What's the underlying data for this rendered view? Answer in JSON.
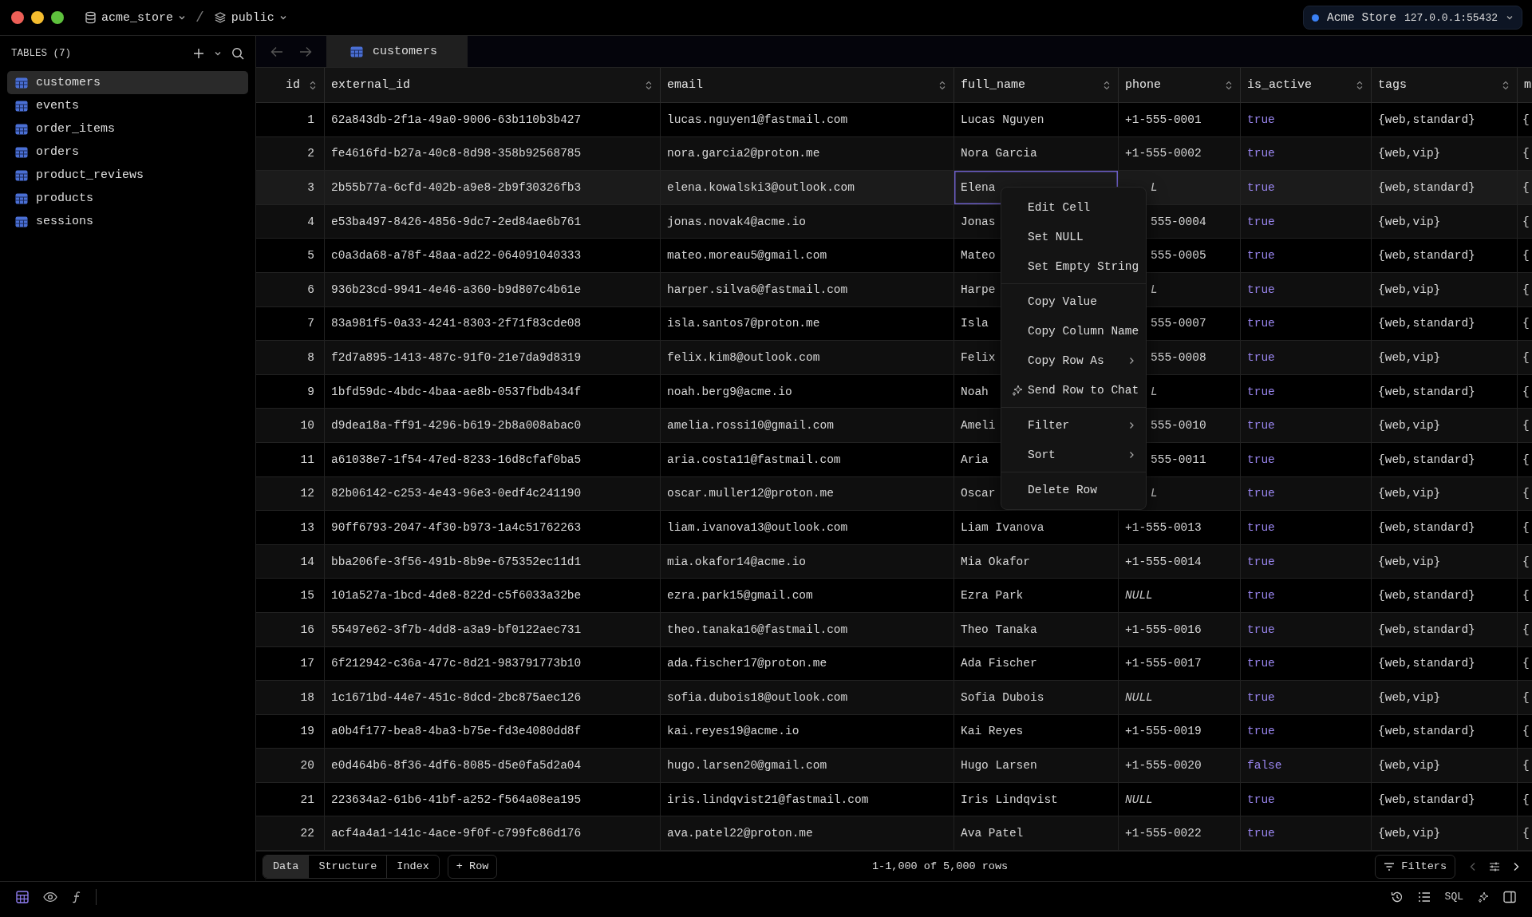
{
  "titlebar": {
    "database": "acme_store",
    "separator": "/",
    "schema": "public",
    "connection": {
      "name": "Acme Store",
      "address": "127.0.0.1:55432",
      "color": "#3b82f6"
    }
  },
  "sidebar": {
    "title": "TABLES (7)",
    "items": [
      {
        "label": "customers",
        "selected": true
      },
      {
        "label": "events",
        "selected": false
      },
      {
        "label": "order_items",
        "selected": false
      },
      {
        "label": "orders",
        "selected": false
      },
      {
        "label": "product_reviews",
        "selected": false
      },
      {
        "label": "products",
        "selected": false
      },
      {
        "label": "sessions",
        "selected": false
      }
    ]
  },
  "tabs": [
    {
      "label": "customers",
      "selected": true
    }
  ],
  "table": {
    "columns": [
      {
        "label": "id",
        "kind": "number"
      },
      {
        "label": "external_id",
        "kind": "plain"
      },
      {
        "label": "email",
        "kind": "plain"
      },
      {
        "label": "full_name",
        "kind": "plain"
      },
      {
        "label": "phone",
        "kind": "plain"
      },
      {
        "label": "is_active",
        "kind": "boolean"
      },
      {
        "label": "tags",
        "kind": "plain"
      },
      {
        "label": "m",
        "kind": "partial"
      }
    ],
    "rows": [
      {
        "selected": false,
        "cells": [
          "1",
          "62a843db-2f1a-49a0-9006-63b110b3b427",
          "lucas.nguyen1@fastmail.com",
          "Lucas Nguyen",
          "+1-555-0001",
          "true",
          "{web,standard}",
          "{"
        ]
      },
      {
        "selected": false,
        "cells": [
          "2",
          "fe4616fd-b27a-40c8-8d98-358b92568785",
          "nora.garcia2@proton.me",
          "Nora Garcia",
          "+1-555-0002",
          "true",
          "{web,vip}",
          "{"
        ]
      },
      {
        "selected": true,
        "cells": [
          "3",
          "2b55b77a-6cfd-402b-a9e8-2b9f30326fb3",
          "elena.kowalski3@outlook.com",
          {
            "text": "Elena",
            "kind": "focused"
          },
          {
            "text": "L",
            "kind": "covered-null"
          },
          "true",
          "{web,standard}",
          "{"
        ]
      },
      {
        "selected": false,
        "cells": [
          "4",
          "e53ba497-8426-4856-9dc7-2ed84ae6b761",
          "jonas.novak4@acme.io",
          "Jonas",
          {
            "text": "555-0004",
            "kind": "covered"
          },
          "true",
          "{web,vip}",
          "{"
        ]
      },
      {
        "selected": false,
        "cells": [
          "5",
          "c0a3da68-a78f-48aa-ad22-064091040333",
          "mateo.moreau5@gmail.com",
          "Mateo",
          {
            "text": "555-0005",
            "kind": "covered"
          },
          "true",
          "{web,standard}",
          "{"
        ]
      },
      {
        "selected": false,
        "cells": [
          "6",
          "936b23cd-9941-4e46-a360-b9d807c4b61e",
          "harper.silva6@fastmail.com",
          "Harpe",
          {
            "text": "L",
            "kind": "covered-null"
          },
          "true",
          "{web,vip}",
          "{"
        ]
      },
      {
        "selected": false,
        "cells": [
          "7",
          "83a981f5-0a33-4241-8303-2f71f83cde08",
          "isla.santos7@proton.me",
          "Isla",
          {
            "text": "555-0007",
            "kind": "covered"
          },
          "true",
          "{web,standard}",
          "{"
        ]
      },
      {
        "selected": false,
        "cells": [
          "8",
          "f2d7a895-1413-487c-91f0-21e7da9d8319",
          "felix.kim8@outlook.com",
          "Felix",
          {
            "text": "555-0008",
            "kind": "covered"
          },
          "true",
          "{web,vip}",
          "{"
        ]
      },
      {
        "selected": false,
        "cells": [
          "9",
          "1bfd59dc-4bdc-4baa-ae8b-0537fbdb434f",
          "noah.berg9@acme.io",
          "Noah",
          {
            "text": "L",
            "kind": "covered-null"
          },
          "true",
          "{web,standard}",
          "{"
        ]
      },
      {
        "selected": false,
        "cells": [
          "10",
          "d9dea18a-ff91-4296-b619-2b8a008abac0",
          "amelia.rossi10@gmail.com",
          "Ameli",
          {
            "text": "555-0010",
            "kind": "covered"
          },
          "true",
          "{web,vip}",
          "{"
        ]
      },
      {
        "selected": false,
        "cells": [
          "11",
          "a61038e7-1f54-47ed-8233-16d8cfaf0ba5",
          "aria.costa11@fastmail.com",
          "Aria",
          {
            "text": "555-0011",
            "kind": "covered"
          },
          "true",
          "{web,standard}",
          "{"
        ]
      },
      {
        "selected": false,
        "cells": [
          "12",
          "82b06142-c253-4e43-96e3-0edf4c241190",
          "oscar.muller12@proton.me",
          "Oscar",
          {
            "text": "L",
            "kind": "covered-null"
          },
          "true",
          "{web,vip}",
          "{"
        ]
      },
      {
        "selected": false,
        "cells": [
          "13",
          "90ff6793-2047-4f30-b973-1a4c51762263",
          "liam.ivanova13@outlook.com",
          "Liam Ivanova",
          "+1-555-0013",
          "true",
          "{web,standard}",
          "{"
        ]
      },
      {
        "selected": false,
        "cells": [
          "14",
          "bba206fe-3f56-491b-8b9e-675352ec11d1",
          "mia.okafor14@acme.io",
          "Mia Okafor",
          "+1-555-0014",
          "true",
          "{web,vip}",
          "{"
        ]
      },
      {
        "selected": false,
        "cells": [
          "15",
          "101a527a-1bcd-4de8-822d-c5f6033a32be",
          "ezra.park15@gmail.com",
          "Ezra Park",
          {
            "text": "NULL",
            "kind": "null"
          },
          "true",
          "{web,standard}",
          "{"
        ]
      },
      {
        "selected": false,
        "cells": [
          "16",
          "55497e62-3f7b-4dd8-a3a9-bf0122aec731",
          "theo.tanaka16@fastmail.com",
          "Theo Tanaka",
          "+1-555-0016",
          "true",
          "{web,standard}",
          "{"
        ]
      },
      {
        "selected": false,
        "cells": [
          "17",
          "6f212942-c36a-477c-8d21-983791773b10",
          "ada.fischer17@proton.me",
          "Ada Fischer",
          "+1-555-0017",
          "true",
          "{web,standard}",
          "{"
        ]
      },
      {
        "selected": false,
        "cells": [
          "18",
          "1c1671bd-44e7-451c-8dcd-2bc875aec126",
          "sofia.dubois18@outlook.com",
          "Sofia Dubois",
          {
            "text": "NULL",
            "kind": "null"
          },
          "true",
          "{web,vip}",
          "{"
        ]
      },
      {
        "selected": false,
        "cells": [
          "19",
          "a0b4f177-bea8-4ba3-b75e-fd3e4080dd8f",
          "kai.reyes19@acme.io",
          "Kai Reyes",
          "+1-555-0019",
          "true",
          "{web,standard}",
          "{"
        ]
      },
      {
        "selected": false,
        "cells": [
          "20",
          "e0d464b6-8f36-4df6-8085-d5e0fa5d2a04",
          "hugo.larsen20@gmail.com",
          "Hugo Larsen",
          "+1-555-0020",
          "false",
          "{web,vip}",
          "{"
        ]
      },
      {
        "selected": false,
        "cells": [
          "21",
          "223634a2-61b6-41bf-a252-f564a08ea195",
          "iris.lindqvist21@fastmail.com",
          "Iris Lindqvist",
          {
            "text": "NULL",
            "kind": "null"
          },
          "true",
          "{web,standard}",
          "{"
        ]
      },
      {
        "selected": false,
        "cells": [
          "22",
          "acf4a4a1-141c-4ace-9f0f-c799fc86d176",
          "ava.patel22@proton.me",
          "Ava Patel",
          "+1-555-0022",
          "true",
          "{web,vip}",
          "{"
        ]
      }
    ]
  },
  "context_menu": {
    "groups": [
      [
        {
          "label": "Edit Cell",
          "kind": "item"
        },
        {
          "label": "Set NULL",
          "kind": "item"
        },
        {
          "label": "Set Empty String",
          "kind": "item"
        }
      ],
      [
        {
          "label": "Copy Value",
          "kind": "item"
        },
        {
          "label": "Copy Column Name",
          "kind": "item"
        },
        {
          "label": "Copy Row As",
          "kind": "submenu"
        },
        {
          "label": "Send Row to Chat",
          "kind": "ai"
        }
      ],
      [
        {
          "label": "Filter",
          "kind": "submenu"
        },
        {
          "label": "Sort",
          "kind": "submenu"
        }
      ],
      [
        {
          "label": "Delete Row",
          "kind": "item"
        }
      ]
    ]
  },
  "footer": {
    "views": [
      {
        "label": "Data",
        "selected": true
      },
      {
        "label": "Structure",
        "selected": false
      },
      {
        "label": "Index",
        "selected": false
      }
    ],
    "add_row": "+ Row",
    "count": "1-1,000 of 5,000 rows",
    "filters": "Filters"
  },
  "status_bar": {
    "left": [
      {
        "kind": "grid",
        "selected": true
      },
      {
        "kind": "eye",
        "selected": false
      },
      {
        "kind": "function",
        "selected": false
      }
    ],
    "sql": "SQL"
  }
}
